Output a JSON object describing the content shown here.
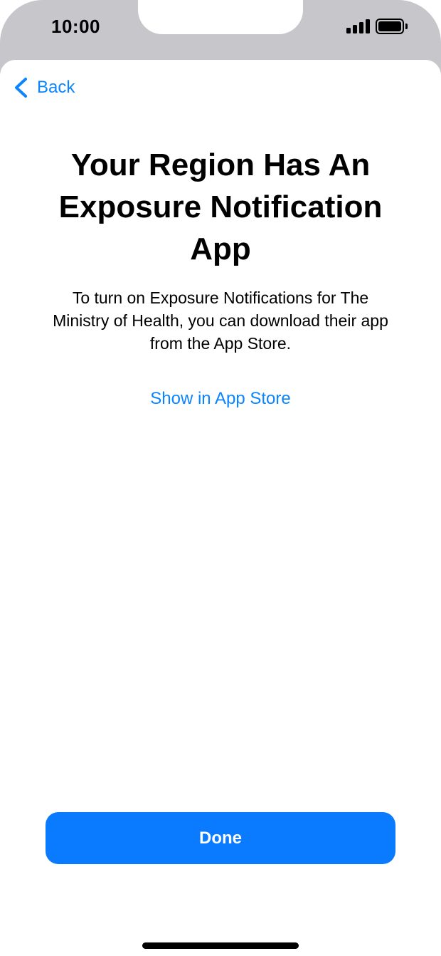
{
  "status_bar": {
    "time": "10:00",
    "signal_icon": "cellular-signal-icon",
    "battery_icon": "battery-full-icon"
  },
  "nav": {
    "back_label": "Back",
    "back_icon": "chevron-left-icon"
  },
  "content": {
    "title": "Your Region Has An Exposure Notification App",
    "body": "To turn on Exposure Notifications for The Ministry of Health, you can download their app from the App Store.",
    "link_label": "Show in App Store"
  },
  "footer": {
    "done_label": "Done"
  },
  "colors": {
    "accent": "#0a84ff",
    "button": "#0a7aff",
    "status_background": "#c6c6cb"
  }
}
